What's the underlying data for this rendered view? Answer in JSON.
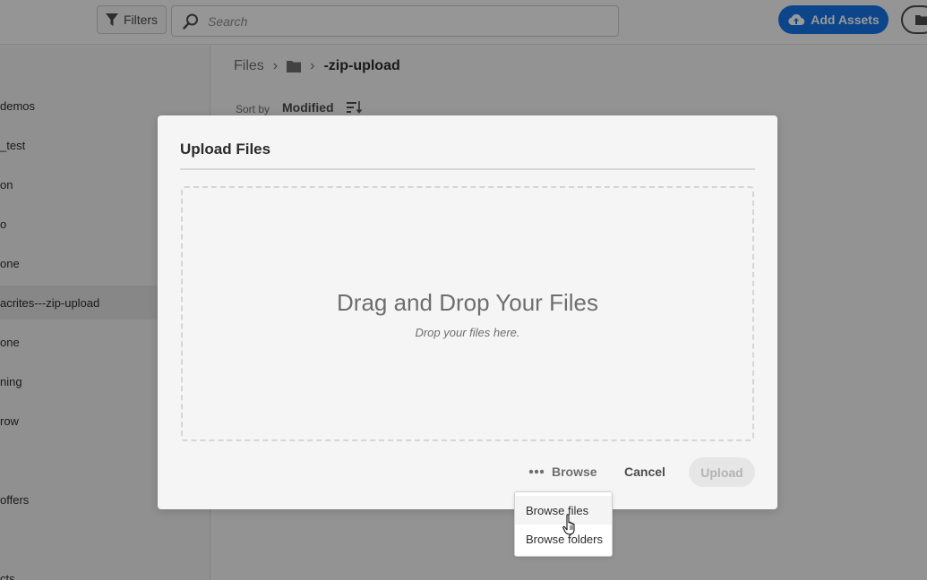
{
  "topbar": {
    "filters_label": "Filters",
    "search_placeholder": "Search",
    "add_assets_label": "Add Assets"
  },
  "sidebar": {
    "items": [
      {
        "label": "demos"
      },
      {
        "label": "_test"
      },
      {
        "label": "on"
      },
      {
        "label": "o"
      },
      {
        "label": "one"
      },
      {
        "label": "acrites---zip-upload",
        "selected": true
      },
      {
        "label": "one"
      },
      {
        "label": "ning"
      },
      {
        "label": "row"
      },
      {
        "label": ""
      },
      {
        "label": "offers"
      },
      {
        "label": ""
      },
      {
        "label": "cts"
      }
    ]
  },
  "breadcrumb": {
    "root": "Files",
    "separator": "›",
    "current": "-zip-upload"
  },
  "sort": {
    "label": "Sort by",
    "value": "Modified"
  },
  "dialog": {
    "title": "Upload Files",
    "drop_title": "Drag and Drop Your Files",
    "drop_subtitle": "Drop your files here.",
    "browse_label": "Browse",
    "cancel_label": "Cancel",
    "upload_label": "Upload"
  },
  "browse_menu": {
    "items": [
      {
        "label": "Browse files"
      },
      {
        "label": "Browse folders"
      }
    ]
  },
  "colors": {
    "accent": "#1473e6",
    "overlay": "rgba(0,0,0,0.40)"
  }
}
